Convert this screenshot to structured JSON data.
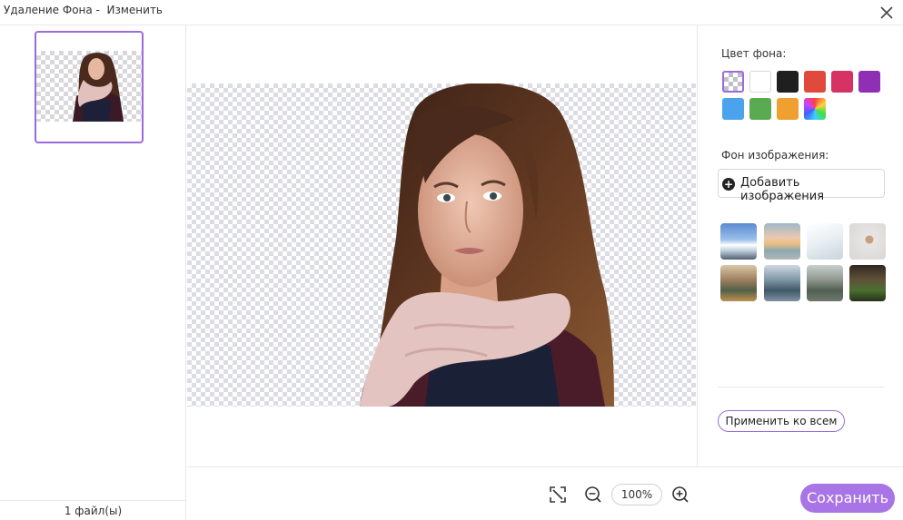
{
  "window": {
    "title": "Удаление Фона -  Изменить"
  },
  "left_panel": {
    "file_count": "1 файл(ы)"
  },
  "toolbar": {
    "zoom": "100%",
    "save_label": "Сохранить"
  },
  "right_panel": {
    "bg_color_label": "Цвет фона:",
    "colors": [
      {
        "name": "transparent",
        "hex": "transparent"
      },
      {
        "name": "white",
        "hex": "#ffffff"
      },
      {
        "name": "black",
        "hex": "#1f1f1f"
      },
      {
        "name": "red",
        "hex": "#e04a3c"
      },
      {
        "name": "crimson",
        "hex": "#d63364"
      },
      {
        "name": "purple",
        "hex": "#8e2fb4"
      },
      {
        "name": "blue",
        "hex": "#4aa3ec"
      },
      {
        "name": "green",
        "hex": "#5aaa52"
      },
      {
        "name": "orange",
        "hex": "#f0a030"
      },
      {
        "name": "gradient",
        "hex": "multicolor"
      }
    ],
    "bg_image_label": "Фон изображения:",
    "add_image_label": "Добавить изображения",
    "apply_all_label": "Применить ко всем"
  },
  "colors": {
    "accent": "#a874e6",
    "selection_border": "#9b6bdc"
  }
}
